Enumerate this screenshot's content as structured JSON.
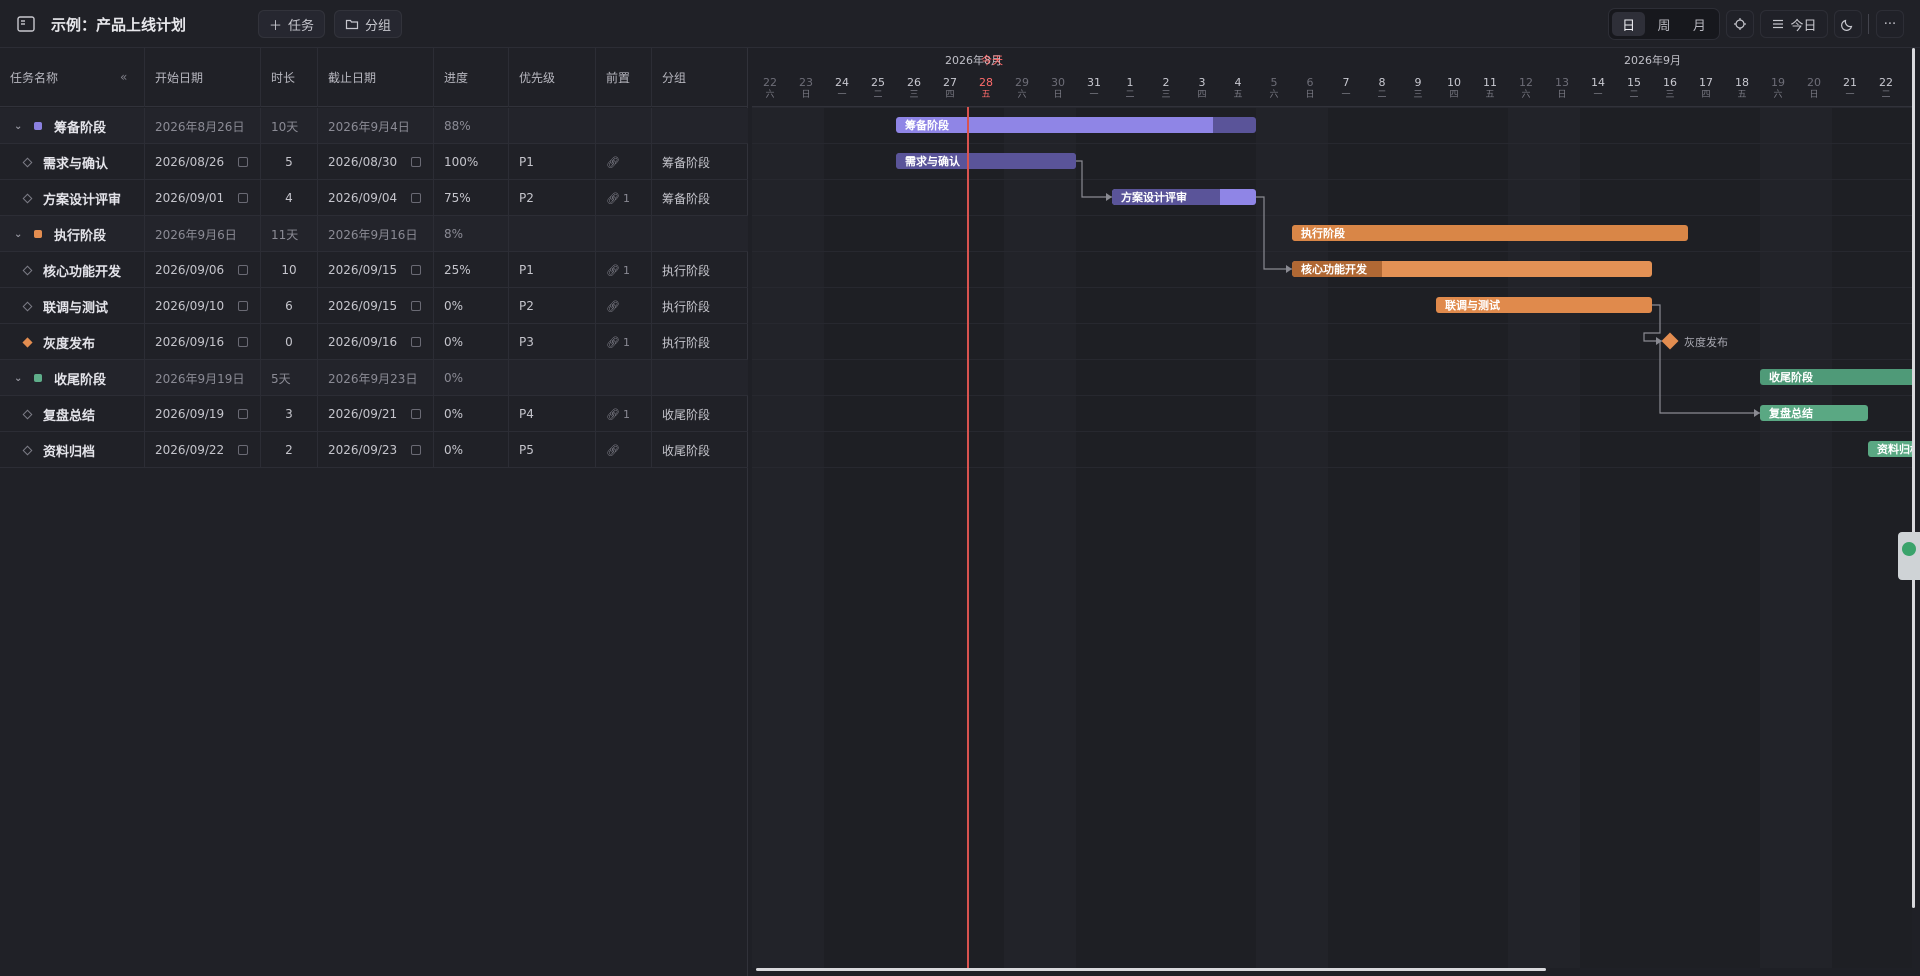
{
  "header": {
    "title": "示例：产品上线计划",
    "add_task": "任务",
    "add_group": "分组",
    "views": [
      "日",
      "周",
      "月"
    ],
    "active_view": "日",
    "today": "今日"
  },
  "columns": [
    "任务名称",
    "开始日期",
    "时长",
    "截止日期",
    "进度",
    "优先级",
    "前置",
    "分组"
  ],
  "rows": [
    {
      "type": "group",
      "name": "筹备阶段",
      "color": "#8b80e0",
      "start": "2026年8月26日",
      "duration": "10天",
      "end": "2026年9月4日",
      "progress": "88%"
    },
    {
      "type": "task",
      "name": "需求与确认",
      "start": "2026/08/26",
      "duration": "5",
      "end": "2026/08/30",
      "progress": "100%",
      "priority": "P1",
      "pre": "",
      "group": "筹备阶段"
    },
    {
      "type": "task",
      "name": "方案设计评审",
      "start": "2026/09/01",
      "duration": "4",
      "end": "2026/09/04",
      "progress": "75%",
      "priority": "P2",
      "pre": "1",
      "group": "筹备阶段"
    },
    {
      "type": "group",
      "name": "执行阶段",
      "color": "#e38d50",
      "start": "2026年9月6日",
      "duration": "11天",
      "end": "2026年9月16日",
      "progress": "8%"
    },
    {
      "type": "task",
      "name": "核心功能开发",
      "start": "2026/09/06",
      "duration": "10",
      "end": "2026/09/15",
      "progress": "25%",
      "priority": "P1",
      "pre": "1",
      "group": "执行阶段"
    },
    {
      "type": "task",
      "name": "联调与测试",
      "start": "2026/09/10",
      "duration": "6",
      "end": "2026/09/15",
      "progress": "0%",
      "priority": "P2",
      "pre": "",
      "group": "执行阶段"
    },
    {
      "type": "milestone",
      "name": "灰度发布",
      "start": "2026/09/16",
      "duration": "0",
      "end": "2026/09/16",
      "progress": "0%",
      "priority": "P3",
      "pre": "1",
      "group": "执行阶段"
    },
    {
      "type": "group",
      "name": "收尾阶段",
      "color": "#5fae8a",
      "start": "2026年9月19日",
      "duration": "5天",
      "end": "2026年9月23日",
      "progress": "0%"
    },
    {
      "type": "task",
      "name": "复盘总结",
      "start": "2026/09/19",
      "duration": "3",
      "end": "2026/09/21",
      "progress": "0%",
      "priority": "P4",
      "pre": "1",
      "group": "收尾阶段"
    },
    {
      "type": "task",
      "name": "资料归档",
      "start": "2026/09/22",
      "duration": "2",
      "end": "2026/09/23",
      "progress": "0%",
      "priority": "P5",
      "pre": "",
      "group": "收尾阶段"
    }
  ],
  "timeline": {
    "months": [
      {
        "label": "2026年8月"
      },
      {
        "label": "2026年9月"
      }
    ],
    "today_label": "今天",
    "days": [
      {
        "d": "22",
        "w": "六"
      },
      {
        "d": "23",
        "w": "日"
      },
      {
        "d": "24",
        "w": "一"
      },
      {
        "d": "25",
        "w": "二"
      },
      {
        "d": "26",
        "w": "三"
      },
      {
        "d": "27",
        "w": "四"
      },
      {
        "d": "28",
        "w": "五",
        "today": true
      },
      {
        "d": "29",
        "w": "六"
      },
      {
        "d": "30",
        "w": "日"
      },
      {
        "d": "31",
        "w": "一"
      },
      {
        "d": "1",
        "w": "二"
      },
      {
        "d": "2",
        "w": "三"
      },
      {
        "d": "3",
        "w": "四"
      },
      {
        "d": "4",
        "w": "五"
      },
      {
        "d": "5",
        "w": "六"
      },
      {
        "d": "6",
        "w": "日"
      },
      {
        "d": "7",
        "w": "一"
      },
      {
        "d": "8",
        "w": "二"
      },
      {
        "d": "9",
        "w": "三"
      },
      {
        "d": "10",
        "w": "四"
      },
      {
        "d": "11",
        "w": "五"
      },
      {
        "d": "12",
        "w": "六"
      },
      {
        "d": "13",
        "w": "日"
      },
      {
        "d": "14",
        "w": "一"
      },
      {
        "d": "15",
        "w": "二"
      },
      {
        "d": "16",
        "w": "三"
      },
      {
        "d": "17",
        "w": "四"
      },
      {
        "d": "18",
        "w": "五"
      },
      {
        "d": "19",
        "w": "六"
      },
      {
        "d": "20",
        "w": "日"
      },
      {
        "d": "21",
        "w": "一"
      },
      {
        "d": "22",
        "w": "二"
      }
    ]
  },
  "bars": [
    {
      "label": "筹备阶段",
      "row": 0,
      "start": "2026-08-26",
      "end": "2026-09-04",
      "progress": 0.88,
      "color": "#5a5499",
      "fill": "#8f85e6"
    },
    {
      "label": "需求与确认",
      "row": 1,
      "start": "2026-08-26",
      "end": "2026-08-30",
      "progress": 1.0,
      "color": "#5a5499",
      "fill": "#5a5499"
    },
    {
      "label": "方案设计评审",
      "row": 2,
      "start": "2026-09-01",
      "end": "2026-09-04",
      "progress": 0.75,
      "color": "#8f85e6",
      "fill": "#5a5499"
    },
    {
      "label": "执行阶段",
      "row": 3,
      "start": "2026-09-06",
      "end": "2026-09-16",
      "progress": 0.08,
      "color": "#d98647",
      "fill": "#d98647"
    },
    {
      "label": "核心功能开发",
      "row": 4,
      "start": "2026-09-06",
      "end": "2026-09-15",
      "progress": 0.25,
      "color": "#e39155",
      "fill": "#b06834"
    },
    {
      "label": "联调与测试",
      "row": 5,
      "start": "2026-09-10",
      "end": "2026-09-15",
      "progress": 0,
      "color": "#e08a4c",
      "fill": "#e08a4c"
    },
    {
      "label": "收尾阶段",
      "row": 7,
      "start": "2026-09-19",
      "end": "2026-09-23",
      "progress": 0,
      "color": "#4f9a78",
      "fill": "#4f9a78"
    },
    {
      "label": "复盘总结",
      "row": 8,
      "start": "2026-09-19",
      "end": "2026-09-21",
      "progress": 0,
      "color": "#5aa883",
      "fill": "#5aa883"
    },
    {
      "label": "资料归档",
      "row": 9,
      "start": "2026-09-22",
      "end": "2026-09-23",
      "progress": 0,
      "color": "#5aa883",
      "fill": "#5aa883"
    }
  ],
  "milestone": {
    "label": "灰度发布",
    "row": 6,
    "date": "2026-09-16"
  }
}
